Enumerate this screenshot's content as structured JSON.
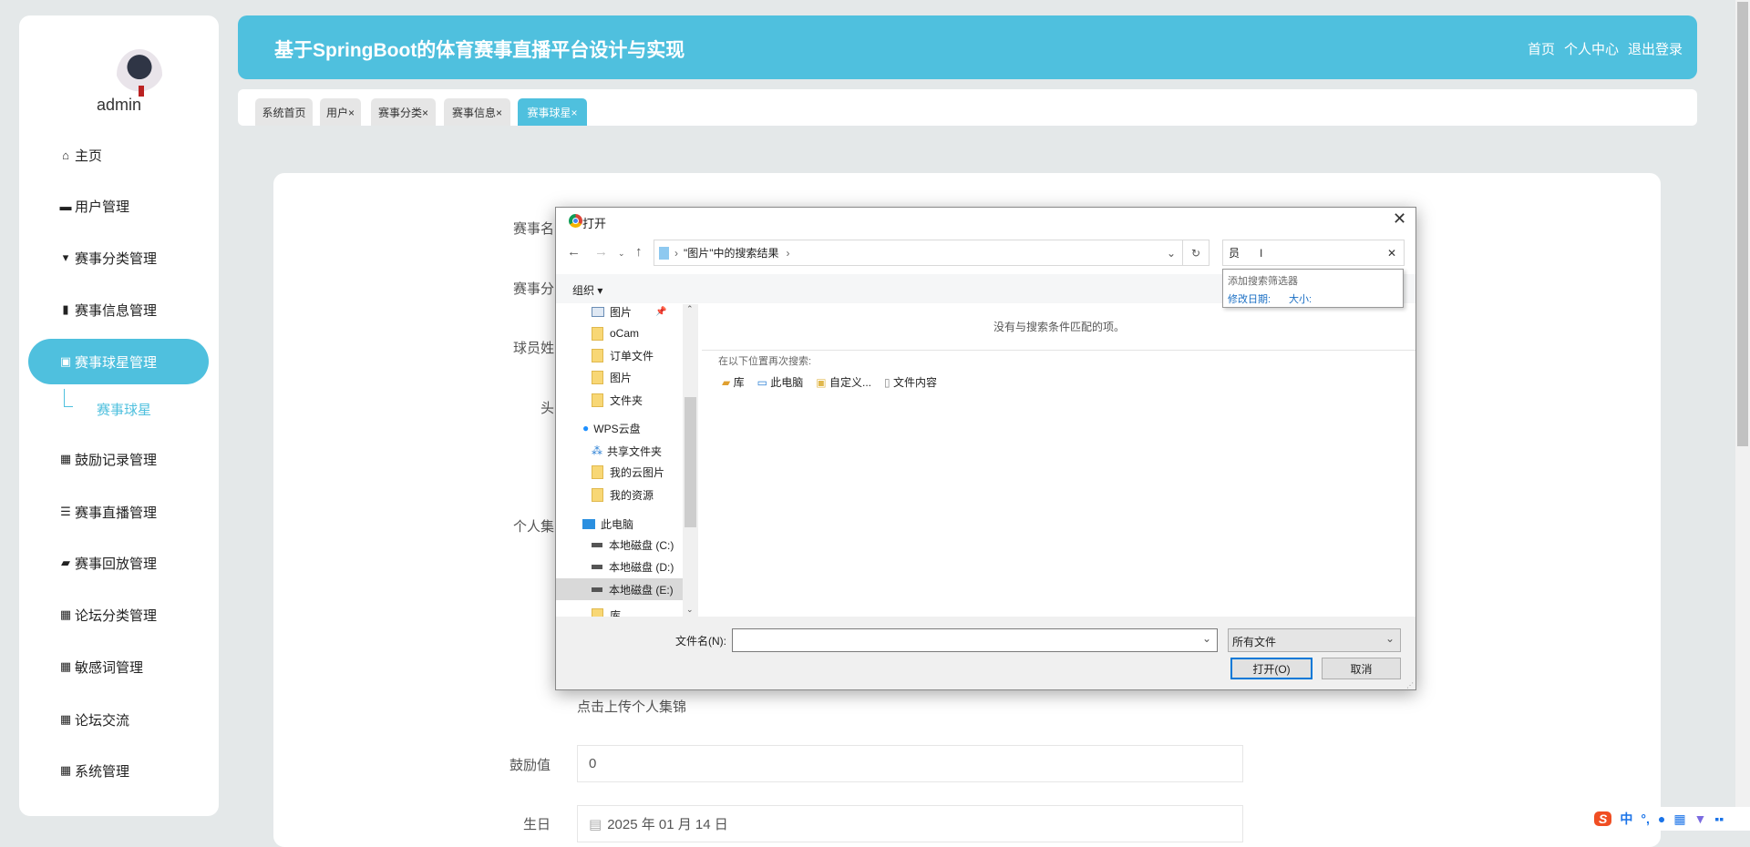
{
  "sidebar": {
    "username": "admin",
    "items": [
      {
        "label": "主页",
        "icon": "home-icon"
      },
      {
        "label": "用户管理",
        "icon": "user-icon"
      },
      {
        "label": "赛事分类管理",
        "icon": "category-icon"
      },
      {
        "label": "赛事信息管理",
        "icon": "chart-icon"
      },
      {
        "label": "赛事球星管理",
        "icon": "clipboard-icon",
        "active": true
      },
      {
        "label": "鼓励记录管理",
        "icon": "grid-icon"
      },
      {
        "label": "赛事直播管理",
        "icon": "sliders-icon"
      },
      {
        "label": "赛事回放管理",
        "icon": "wallet-icon"
      },
      {
        "label": "论坛分类管理",
        "icon": "grid-icon"
      },
      {
        "label": "敏感词管理",
        "icon": "grid-icon"
      },
      {
        "label": "论坛交流",
        "icon": "grid-icon"
      },
      {
        "label": "系统管理",
        "icon": "grid-icon"
      }
    ],
    "subitem": "赛事球星"
  },
  "header": {
    "title": "基于SpringBoot的体育赛事直播平台设计与实现",
    "links": [
      "首页",
      "个人中心",
      "退出登录"
    ]
  },
  "tabs": [
    {
      "label": "系统首页"
    },
    {
      "label": "用户×"
    },
    {
      "label": "赛事分类×"
    },
    {
      "label": "赛事信息×"
    },
    {
      "label": "赛事球星×",
      "active": true
    }
  ],
  "form": {
    "labels": [
      "赛事名",
      "赛事分",
      "球员姓",
      "头",
      "个人集"
    ],
    "upload_hint": "点击上传个人集锦",
    "encourage_label": "鼓励值",
    "encourage_value": "0",
    "birthday_label": "生日",
    "birthday_value": "2025 年 01 月 14 日"
  },
  "dialog": {
    "title": "打开",
    "path": "\"图片\"中的搜索结果",
    "search_value": "员",
    "suggest_title": "添加搜索筛选器",
    "suggest_date": "修改日期:",
    "suggest_size": "大小:",
    "organize": "组织 ▾",
    "nav": [
      {
        "label": "图片",
        "type": "pic"
      },
      {
        "label": "oCam"
      },
      {
        "label": "订单文件"
      },
      {
        "label": "图片"
      },
      {
        "label": "文件夹"
      },
      {
        "label": "WPS云盘",
        "type": "cloud"
      },
      {
        "label": "共享文件夹",
        "type": "share"
      },
      {
        "label": "我的云图片"
      },
      {
        "label": "我的资源"
      },
      {
        "label": "此电脑",
        "type": "pc"
      },
      {
        "label": "本地磁盘 (C:)",
        "type": "disk"
      },
      {
        "label": "本地磁盘 (D:)",
        "type": "disk"
      },
      {
        "label": "本地磁盘 (E:)",
        "type": "disk",
        "selected": true
      },
      {
        "label": "库"
      }
    ],
    "no_results": "没有与搜索条件匹配的项。",
    "search_again": "在以下位置再次搜索:",
    "locations": [
      "库",
      "此电脑",
      "自定义...",
      "文件内容"
    ],
    "filename_label": "文件名(N):",
    "filename_value": "",
    "filetype": "所有文件",
    "open": "打开(O)",
    "cancel": "取消"
  },
  "ime": {
    "mode": "中",
    "punct": "°,"
  }
}
